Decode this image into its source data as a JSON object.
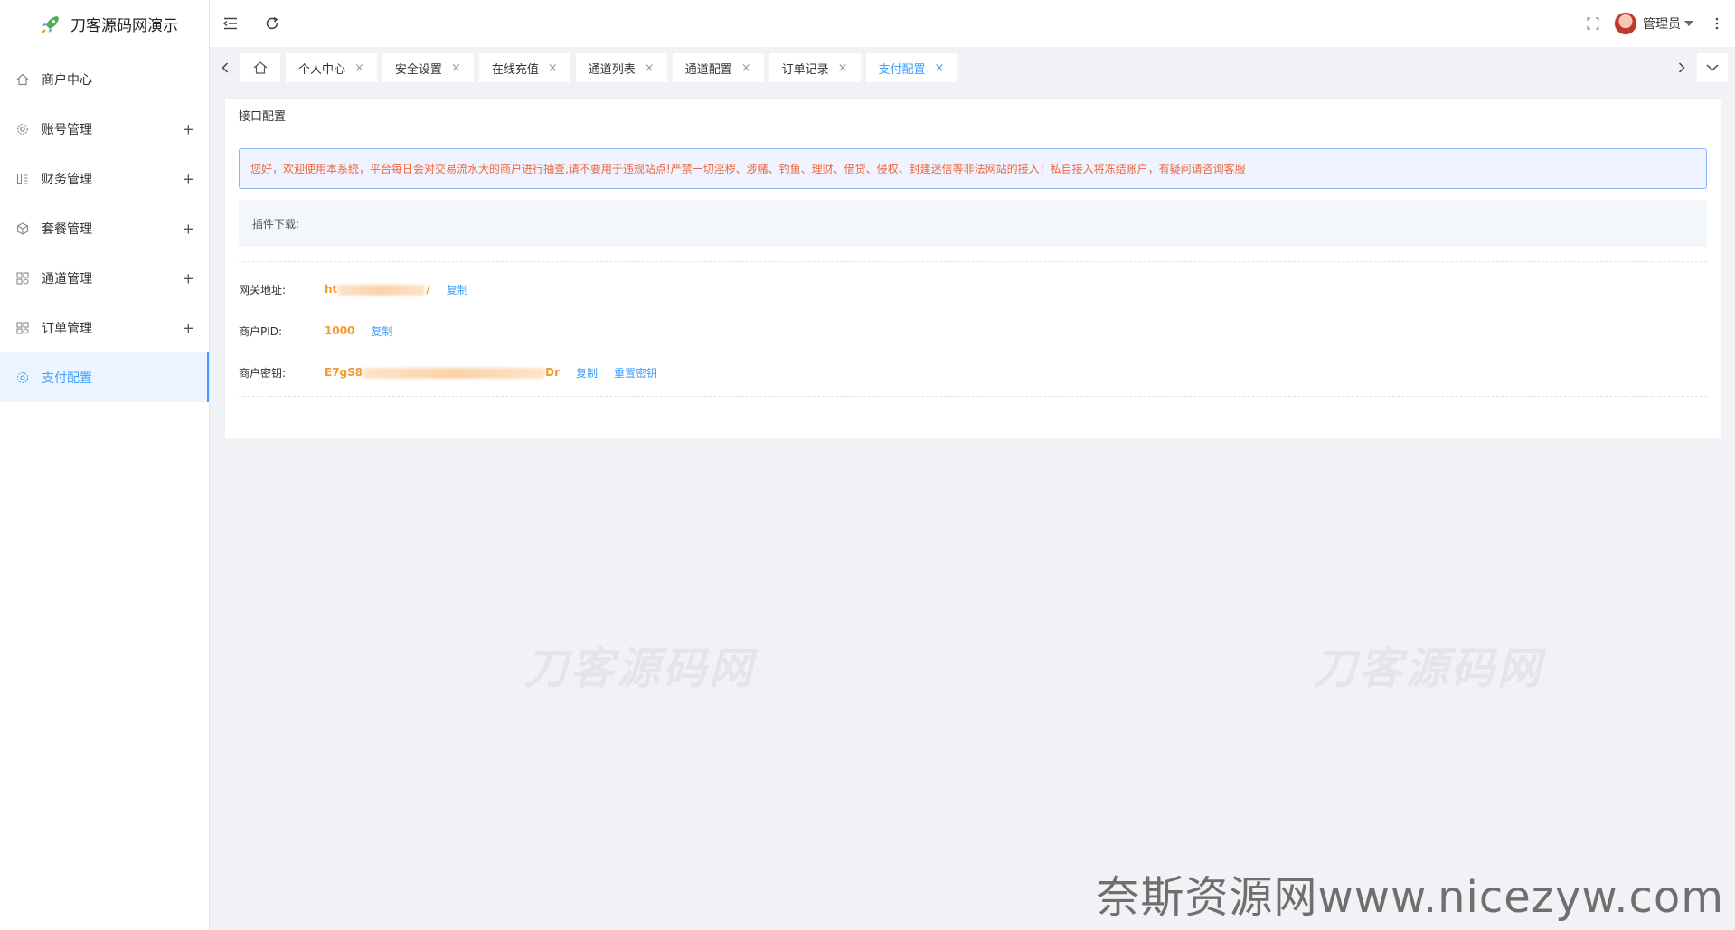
{
  "app": {
    "logo_text": "刀客源码网演示"
  },
  "sidebar": {
    "items": [
      {
        "label": "商户中心",
        "icon": "home-icon",
        "expandable": false
      },
      {
        "label": "账号管理",
        "icon": "gear-icon",
        "expandable": true
      },
      {
        "label": "财务管理",
        "icon": "finance-icon",
        "expandable": true
      },
      {
        "label": "套餐管理",
        "icon": "package-icon",
        "expandable": true
      },
      {
        "label": "通道管理",
        "icon": "grid-icon",
        "expandable": true
      },
      {
        "label": "订单管理",
        "icon": "grid-icon",
        "expandable": true
      },
      {
        "label": "支付配置",
        "icon": "config-icon",
        "expandable": false,
        "active": true
      }
    ],
    "expand_symbol": "+"
  },
  "header": {
    "user": "管理员"
  },
  "tabs": {
    "items": [
      {
        "label": "个人中心"
      },
      {
        "label": "安全设置"
      },
      {
        "label": "在线充值"
      },
      {
        "label": "通道列表"
      },
      {
        "label": "通道配置"
      },
      {
        "label": "订单记录"
      },
      {
        "label": "支付配置",
        "active": true
      }
    ],
    "close_symbol": "×"
  },
  "card": {
    "title": "接口配置",
    "notice": "您好，欢迎使用本系统，平台每日会对交易流水大的商户进行抽查,请不要用于违规站点!严禁一切淫秽、涉赌、钓鱼、理财、借贷、侵权、封建迷信等非法网站的接入！私自接入将冻结账户，有疑问请咨询客服",
    "plugin_label": "插件下载:",
    "gateway": {
      "label": "网关地址:",
      "value_prefix": "ht",
      "value_suffix": "/",
      "copy": "复制"
    },
    "pid": {
      "label": "商户PID:",
      "value": "1000",
      "copy": "复制"
    },
    "key": {
      "label": "商户密钥:",
      "value_prefix": "E7gS8",
      "value_suffix": "Dr",
      "copy": "复制",
      "reset": "重置密钥"
    }
  },
  "watermarks": {
    "left": "刀客源码网",
    "right": "刀客源码网",
    "bottom": "奈斯资源网www.nicezyw.com"
  },
  "colors": {
    "accent": "#409eff",
    "warning_text": "#f0663b",
    "value": "#f39a2b"
  }
}
